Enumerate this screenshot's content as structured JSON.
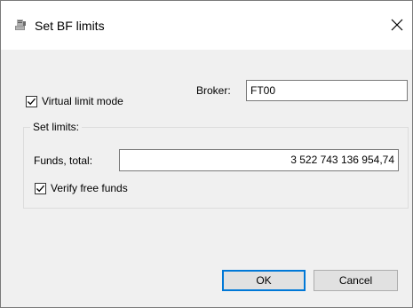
{
  "window": {
    "title": "Set BF limits"
  },
  "broker": {
    "label": "Broker:",
    "value": "FT00"
  },
  "virtual_limit_mode": {
    "label": "Virtual limit mode",
    "checked": true
  },
  "set_limits": {
    "group_title": "Set limits:",
    "funds_label": "Funds, total:",
    "funds_value": "3 522 743 136 954,74",
    "verify_label": "Verify free funds",
    "verify_checked": true
  },
  "buttons": {
    "ok": "OK",
    "cancel": "Cancel"
  },
  "colors": {
    "window_bg": "#f0f0f0",
    "title_bg": "#ffffff",
    "accent": "#0078d7"
  },
  "icons": {
    "title": "dialog-app-icon",
    "close": "close-icon",
    "check": "checkmark-icon"
  }
}
